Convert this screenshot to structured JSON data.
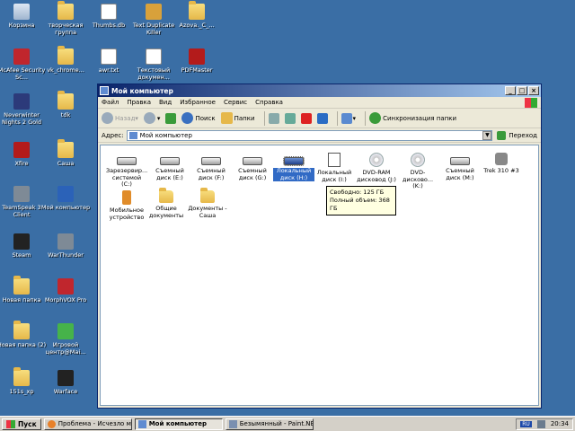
{
  "desktop_icons": [
    {
      "label": "Корзина",
      "icon": "recycle-bin-icon"
    },
    {
      "label": "творческая группа",
      "icon": "folder-icon"
    },
    {
      "label": "Thumbs.db",
      "icon": "file-icon"
    },
    {
      "label": "Text Duplicate Killer",
      "icon": "app-icon"
    },
    {
      "label": "Azova._C_...",
      "icon": "folder-icon"
    },
    {
      "label": "McAfee Security Sc...",
      "icon": "mcafee-icon"
    },
    {
      "label": "vk_chrome...",
      "icon": "folder-icon"
    },
    {
      "label": "awr.txt",
      "icon": "text-file-icon"
    },
    {
      "label": "Текстовый докумен...",
      "icon": "text-file-icon"
    },
    {
      "label": "PDFMaster",
      "icon": "pdf-icon"
    },
    {
      "label": "Neverwinter Nights 2 Gold",
      "icon": "game-icon"
    },
    {
      "label": "tdk",
      "icon": "folder-icon"
    },
    {
      "label": "Xfire",
      "icon": "xfire-icon"
    },
    {
      "label": "Саша",
      "icon": "folder-icon"
    },
    {
      "label": "TeamSpeak 3 Client",
      "icon": "teamspeak-icon"
    },
    {
      "label": "Мой компьютер",
      "icon": "my-computer-icon"
    },
    {
      "label": "Steam",
      "icon": "steam-icon"
    },
    {
      "label": "WarThunder",
      "icon": "warthunder-icon"
    },
    {
      "label": "Новая папка",
      "icon": "folder-icon"
    },
    {
      "label": "MorphVOX Pro",
      "icon": "morphvox-icon"
    },
    {
      "label": "Новая папка (2)",
      "icon": "folder-icon"
    },
    {
      "label": "Игровой центр@Mai...",
      "icon": "game-center-icon"
    },
    {
      "label": "151s_xp",
      "icon": "folder-icon"
    },
    {
      "label": "Warface",
      "icon": "warface-icon"
    }
  ],
  "window": {
    "title": "Мой компьютер",
    "menu": [
      "Файл",
      "Правка",
      "Вид",
      "Избранное",
      "Сервис",
      "Справка"
    ],
    "toolbar": {
      "back": "Назад",
      "search": "Поиск",
      "folders": "Папки",
      "sync": "Синхронизация папки"
    },
    "address": {
      "label": "Адрес:",
      "value": "Мой компьютер",
      "go": "Переход"
    },
    "items": [
      {
        "label": "Зарезервир... системой (C:)",
        "type": "drive"
      },
      {
        "label": "Съемный диск (E:)",
        "type": "drive"
      },
      {
        "label": "Съемный диск (F:)",
        "type": "drive"
      },
      {
        "label": "Съемный диск (G:)",
        "type": "drive"
      },
      {
        "label": "Локальный диск (H:)",
        "type": "local-drive",
        "selected": true
      },
      {
        "label": "Локальный диск (I:)",
        "type": "drive"
      },
      {
        "label": "DVD-RAM дисковод (J:)",
        "type": "cd"
      },
      {
        "label": "DVD-дисково... (K:)",
        "type": "cd"
      },
      {
        "label": "Съемный диск (M:)",
        "type": "drive"
      },
      {
        "label": "Trek 310 #3",
        "type": "camera"
      },
      {
        "label": "Мобильное устройство",
        "type": "mobile"
      },
      {
        "label": "Общие документы",
        "type": "folder"
      },
      {
        "label": "Документы - Саша",
        "type": "folder"
      }
    ],
    "tooltip": {
      "free": "Свободно: 125 ГБ",
      "total": "Полный объем: 368 ГБ"
    }
  },
  "taskbar": {
    "start": "Пуск",
    "tasks": [
      {
        "label": "Проблема - Исчезло мес...",
        "active": false
      },
      {
        "label": "Мой компьютер",
        "active": true
      },
      {
        "label": "Безымянный - Paint.NET...",
        "active": false
      }
    ],
    "lang": "RU",
    "clock": "20:34"
  }
}
